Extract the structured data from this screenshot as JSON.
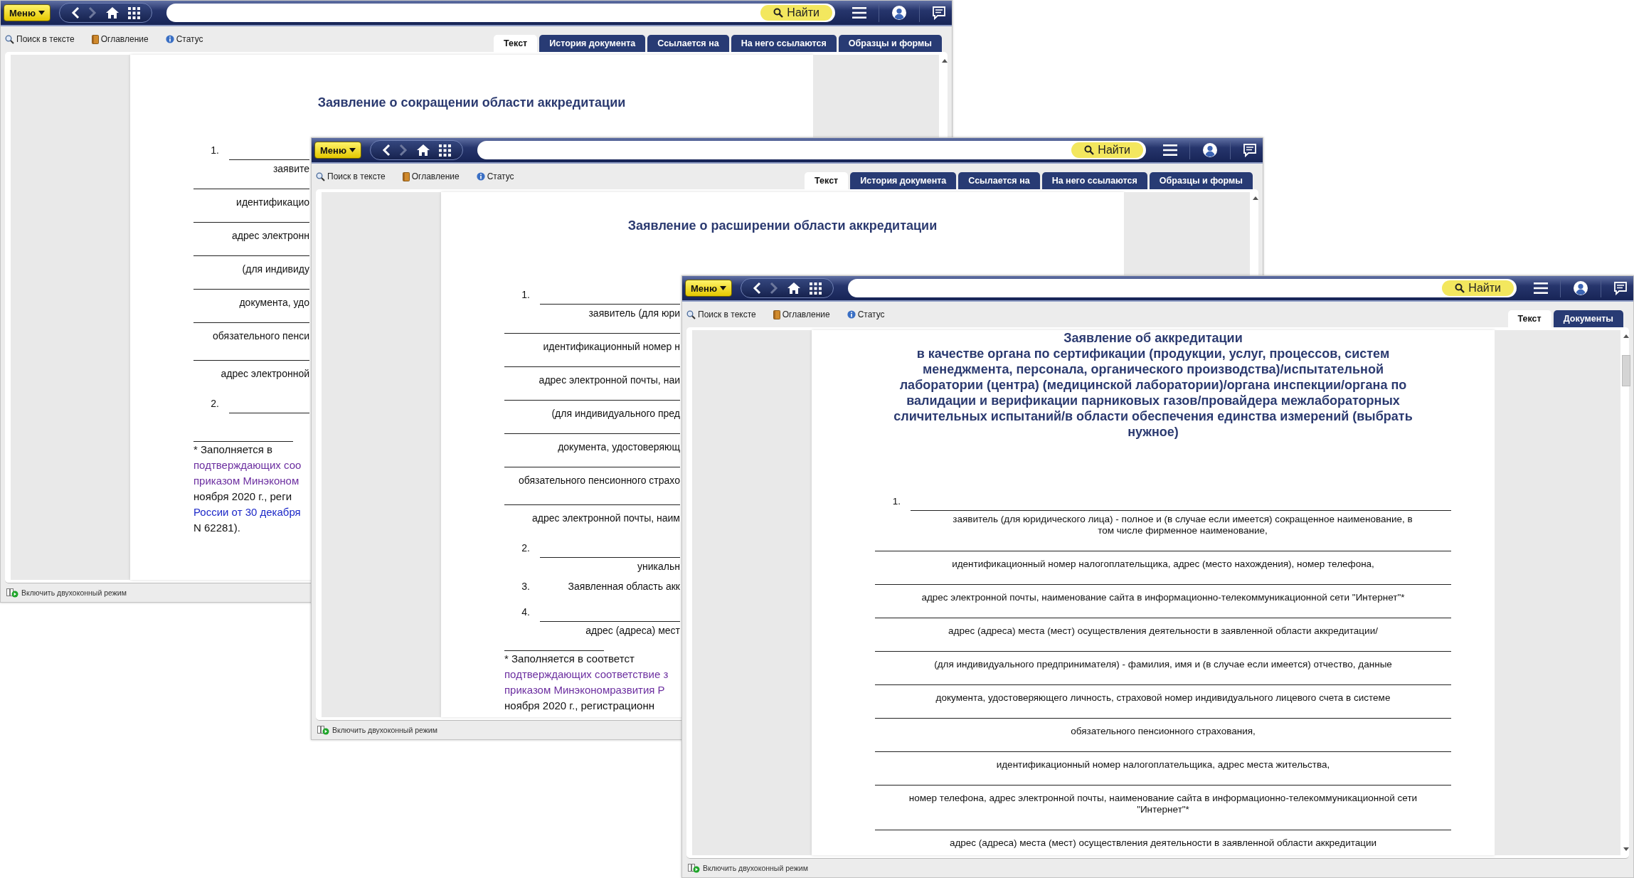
{
  "windows": [
    {
      "menu": "Меню",
      "search_button": "Найти",
      "tools": [
        "Поиск в тексте",
        "Оглавление",
        "Статус"
      ],
      "tabs": [
        {
          "label": "Текст",
          "selected": true
        },
        {
          "label": "История документа",
          "selected": false
        },
        {
          "label": "Ссылается на",
          "selected": false
        },
        {
          "label": "На него ссылаются",
          "selected": false
        },
        {
          "label": "Образцы и формы",
          "selected": false
        }
      ],
      "document": {
        "title": "Заявление о сокращении области аккредитации",
        "items": [
          {
            "kind": "numbered",
            "number": "1."
          },
          {
            "kind": "caption",
            "text": "заявите"
          },
          {
            "kind": "ruled_caption",
            "text": "идентификацио"
          },
          {
            "kind": "ruled_caption",
            "text": "адрес электронн"
          },
          {
            "kind": "ruled_caption",
            "text": "(для индивиду"
          },
          {
            "kind": "ruled_caption",
            "text": "документа, удо"
          },
          {
            "kind": "ruled_caption",
            "text": "обязательного пенси"
          },
          {
            "kind": "spaced_caption",
            "text": "адрес электронной"
          },
          {
            "kind": "numbered",
            "number": "2."
          },
          {
            "kind": "footnote_rule"
          },
          {
            "kind": "footnote",
            "text": "* Заполняется в"
          },
          {
            "kind": "footnote_link",
            "text": "подтверждающих соо",
            "visited": true
          },
          {
            "kind": "footnote_link",
            "text": "приказом Минэконом",
            "visited": true
          },
          {
            "kind": "footnote",
            "text": "ноября 2020 г., реги"
          },
          {
            "kind": "footnote_link",
            "text": "России от 30 декабря",
            "visited": false
          },
          {
            "kind": "footnote",
            "text": "N 62281)."
          }
        ]
      },
      "status_bar": "Включить двухоконный режим"
    },
    {
      "menu": "Меню",
      "search_button": "Найти",
      "tools": [
        "Поиск в тексте",
        "Оглавление",
        "Статус"
      ],
      "tabs": [
        {
          "label": "Текст",
          "selected": true
        },
        {
          "label": "История документа",
          "selected": false
        },
        {
          "label": "Ссылается на",
          "selected": false
        },
        {
          "label": "На него ссылаются",
          "selected": false
        },
        {
          "label": "Образцы и формы",
          "selected": false
        }
      ],
      "document": {
        "title": "Заявление о расширении области аккредитации",
        "items": [
          {
            "kind": "numbered",
            "number": "1."
          },
          {
            "kind": "caption",
            "text": "заявитель (для юри"
          },
          {
            "kind": "ruled_caption",
            "text": "идентификационный номер н"
          },
          {
            "kind": "ruled_caption",
            "text": "адрес электронной почты, наи"
          },
          {
            "kind": "ruled_caption",
            "text": "(для индивидуального пред"
          },
          {
            "kind": "ruled_caption",
            "text": "документа, удостоверяющ"
          },
          {
            "kind": "ruled_caption",
            "text": "обязательного пенсионного страхо"
          },
          {
            "kind": "spaced_caption",
            "text": "адрес электронной почты, наим"
          },
          {
            "kind": "numbered",
            "number": "2."
          },
          {
            "kind": "caption",
            "text": "уникальн"
          },
          {
            "kind": "numbered",
            "number": "3.",
            "text": "Заявленная область акк"
          },
          {
            "kind": "numbered",
            "number": "4."
          },
          {
            "kind": "caption",
            "text": "адрес (адреса) мест"
          },
          {
            "kind": "footnote_rule"
          },
          {
            "kind": "footnote",
            "text": "* Заполняется в соответст"
          },
          {
            "kind": "footnote_link",
            "text": "подтверждающих соответствие з",
            "visited": true
          },
          {
            "kind": "footnote_link",
            "text": "приказом Минэкономразвития Р",
            "visited": true
          },
          {
            "kind": "footnote",
            "text": "ноября 2020 г., регистрационн"
          }
        ]
      },
      "status_bar": "Включить двухоконный режим"
    },
    {
      "menu": "Меню",
      "search_button": "Найти",
      "tools": [
        "Поиск в тексте",
        "Оглавление",
        "Статус"
      ],
      "tabs": [
        {
          "label": "Текст",
          "selected": true
        },
        {
          "label": "Документы",
          "selected": false
        }
      ],
      "document": {
        "title": "Заявление об аккредитации\nв качестве органа по сертификации (продукции, услуг, процессов, систем менеджмента, персонала, органического производства)/испытательной лаборатории (центра) (медицинской лаборатории)/органа инспекции/органа по валидации и верификации парниковых газов/провайдера межлабораторных сличительных испытаний/в области обеспечения единства измерений (выбрать нужное)",
        "items": [
          {
            "kind": "numbered",
            "number": "1."
          },
          {
            "kind": "caption",
            "text": "заявитель (для юридического лица) - полное и (в случае если имеется) сокращенное наименование, в том числе фирменное наименование,"
          },
          {
            "kind": "ruled_caption",
            "text": "идентификационный номер налогоплательщика, адрес (место нахождения), номер телефона,"
          },
          {
            "kind": "ruled_caption",
            "text": "адрес электронной почты, наименование сайта в информационно-телекоммуникационной сети \"Интернет\"*"
          },
          {
            "kind": "ruled_caption",
            "text": "адрес (адреса) места (мест) осуществления деятельности в заявленной области аккредитации/"
          },
          {
            "kind": "ruled_caption",
            "text": "(для индивидуального предпринимателя) - фамилия, имя и (в случае если имеется) отчество, данные"
          },
          {
            "kind": "ruled_caption",
            "text": "документа, удостоверяющего личность, страховой номер индивидуального лицевого счета в системе"
          },
          {
            "kind": "ruled_caption",
            "text": "обязательного пенсионного страхования,"
          },
          {
            "kind": "ruled_caption",
            "text": "идентификационный номер налогоплательщика, адрес места жительства,"
          },
          {
            "kind": "ruled_caption",
            "text": "номер телефона, адрес электронной почты, наименование сайта в информационно-телекоммуникационной сети \"Интернет\"*"
          },
          {
            "kind": "ruled_caption",
            "text": "адрес (адреса) места (мест) осуществления деятельности в заявленной области аккредитации"
          }
        ]
      },
      "status_bar": "Включить двухоконный режим"
    }
  ]
}
